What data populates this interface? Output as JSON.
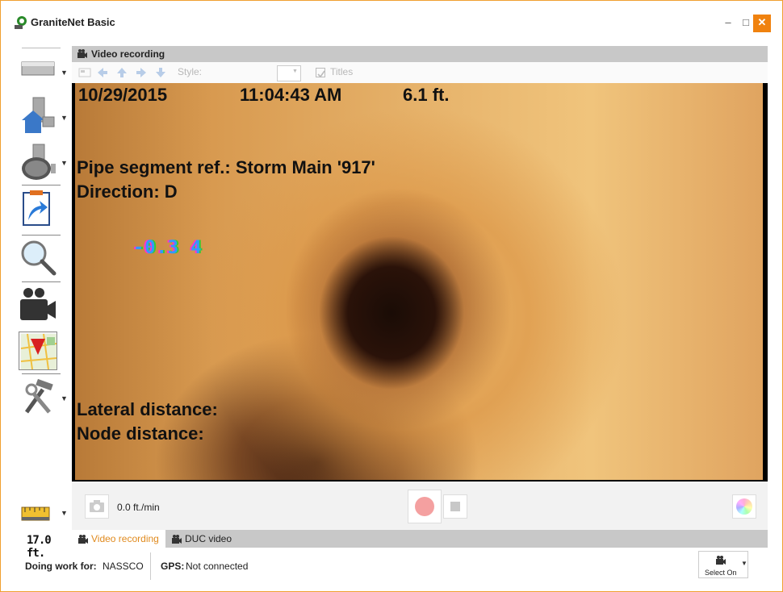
{
  "window": {
    "title": "GraniteNet Basic",
    "minimize_glyph": "–",
    "maximize_glyph": "□",
    "close_glyph": "✕",
    "accent_color": "#f0820f"
  },
  "toolbar": {
    "tools": [
      {
        "name": "pipe-segment-icon",
        "has_dropdown": true
      },
      {
        "name": "lateral-house-icon",
        "has_dropdown": true
      },
      {
        "name": "manhole-icon",
        "has_dropdown": true
      },
      {
        "name": "upload-clipboard-icon",
        "has_dropdown": false
      },
      {
        "name": "magnifier-icon",
        "has_dropdown": false
      },
      {
        "name": "video-camera-icon",
        "has_dropdown": false
      },
      {
        "name": "map-pin-icon",
        "has_dropdown": false,
        "selected": true
      },
      {
        "name": "tools-icon",
        "has_dropdown": true
      }
    ],
    "distance_icon": "tape-measure-icon",
    "distance": "17.0 ft."
  },
  "panel": {
    "title": "Video recording",
    "style_label": "Style:",
    "titles_label": "Titles"
  },
  "video": {
    "date": "10/29/2015",
    "time": "11:04:43 AM",
    "distance": "6.1 ft.",
    "segment": "Pipe segment ref.:  Storm Main '917'",
    "direction": "Direction:  D",
    "gauge": "-0.3 4",
    "lateral": "Lateral distance:",
    "node": "Node distance:"
  },
  "controls": {
    "speed": "0.0 ft./min"
  },
  "tabs": [
    {
      "label": "Video recording",
      "active": true
    },
    {
      "label": "DUC video",
      "active": false
    }
  ],
  "status": {
    "work_label": "Doing work for:",
    "work_value": "NASSCO",
    "gps_label": "GPS:",
    "gps_value": "Not connected",
    "select_on": "Select On"
  }
}
